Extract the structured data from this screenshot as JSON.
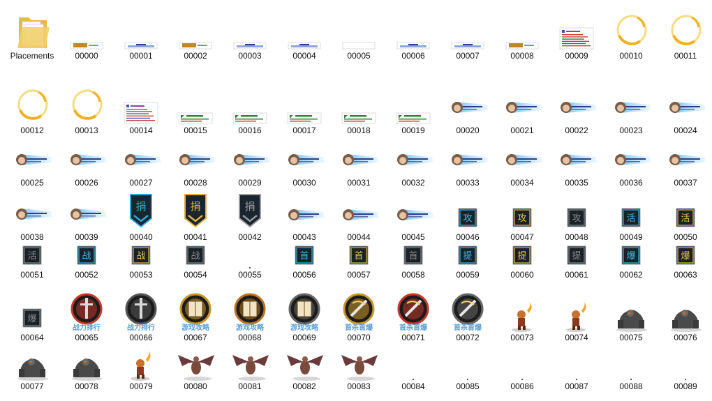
{
  "files": [
    {
      "label": "Placements",
      "icon": "folder-icon"
    },
    {
      "label": "00000",
      "icon": "title-strip-icon"
    },
    {
      "label": "00001",
      "icon": "blue-strip-icon"
    },
    {
      "label": "00002",
      "icon": "title-strip-icon"
    },
    {
      "label": "00003",
      "icon": "blue-strip-icon"
    },
    {
      "label": "00004",
      "icon": "blue-strip-icon"
    },
    {
      "label": "00005",
      "icon": "blank-strip-icon"
    },
    {
      "label": "00006",
      "icon": "blue-strip-icon"
    },
    {
      "label": "00007",
      "icon": "blue-strip-icon"
    },
    {
      "label": "00008",
      "icon": "title-strip-icon"
    },
    {
      "label": "00009",
      "icon": "text-panel-icon"
    },
    {
      "label": "00010",
      "icon": "golden-ring-icon"
    },
    {
      "label": "00011",
      "icon": "golden-ring-icon"
    },
    {
      "label": "00012",
      "icon": "golden-ring-icon"
    },
    {
      "label": "00013",
      "icon": "golden-ring-icon"
    },
    {
      "label": "00014",
      "icon": "text-panel-icon"
    },
    {
      "label": "00015",
      "icon": "green-text-strip-icon"
    },
    {
      "label": "00016",
      "icon": "green-text-strip-icon"
    },
    {
      "label": "00017",
      "icon": "green-text-strip-icon"
    },
    {
      "label": "00018",
      "icon": "green-text-strip-icon"
    },
    {
      "label": "00019",
      "icon": "green-text-strip-icon"
    },
    {
      "label": "00020",
      "icon": "portrait-banner-icon"
    },
    {
      "label": "00021",
      "icon": "portrait-banner-icon"
    },
    {
      "label": "00022",
      "icon": "portrait-banner-icon"
    },
    {
      "label": "00023",
      "icon": "portrait-banner-icon"
    },
    {
      "label": "00024",
      "icon": "portrait-banner-icon"
    },
    {
      "label": "00025",
      "icon": "portrait-banner-icon"
    },
    {
      "label": "00026",
      "icon": "portrait-banner-icon"
    },
    {
      "label": "00027",
      "icon": "portrait-banner-icon"
    },
    {
      "label": "00028",
      "icon": "portrait-banner-icon"
    },
    {
      "label": "00029",
      "icon": "portrait-banner-icon"
    },
    {
      "label": "00030",
      "icon": "portrait-banner-icon"
    },
    {
      "label": "00031",
      "icon": "portrait-banner-icon"
    },
    {
      "label": "00032",
      "icon": "portrait-banner-icon"
    },
    {
      "label": "00033",
      "icon": "portrait-banner-icon"
    },
    {
      "label": "00034",
      "icon": "portrait-banner-icon"
    },
    {
      "label": "00035",
      "icon": "portrait-banner-icon"
    },
    {
      "label": "00036",
      "icon": "portrait-banner-icon"
    },
    {
      "label": "00037",
      "icon": "portrait-banner-icon"
    },
    {
      "label": "00038",
      "icon": "portrait-banner-icon"
    },
    {
      "label": "00039",
      "icon": "portrait-banner-icon"
    },
    {
      "label": "00040",
      "icon": "shield-badge-icon",
      "glyph": "捐",
      "color": "#2aa8d8"
    },
    {
      "label": "00041",
      "icon": "shield-badge-icon",
      "glyph": "捐",
      "color": "#e0b040"
    },
    {
      "label": "00042",
      "icon": "shield-badge-icon",
      "glyph": "捐",
      "color": "#9a9a9a"
    },
    {
      "label": "00043",
      "icon": "portrait-strip-icon"
    },
    {
      "label": "00044",
      "icon": "portrait-strip-icon"
    },
    {
      "label": "00045",
      "icon": "portrait-strip-icon"
    },
    {
      "label": "00046",
      "icon": "square-glyph-icon",
      "glyph": "攻",
      "color": "#3fb6e6"
    },
    {
      "label": "00047",
      "icon": "square-glyph-icon",
      "glyph": "攻",
      "color": "#e3c04a"
    },
    {
      "label": "00048",
      "icon": "square-glyph-icon",
      "glyph": "攻",
      "color": "#8a8a8a"
    },
    {
      "label": "00049",
      "icon": "square-glyph-icon",
      "glyph": "活",
      "color": "#3fb6e6"
    },
    {
      "label": "00050",
      "icon": "square-glyph-icon",
      "glyph": "活",
      "color": "#e3c04a"
    },
    {
      "label": "00051",
      "icon": "square-glyph-icon",
      "glyph": "活",
      "color": "#8a8a8a"
    },
    {
      "label": "00052",
      "icon": "square-glyph-icon",
      "glyph": "战",
      "color": "#3fb6e6"
    },
    {
      "label": "00053",
      "icon": "square-glyph-icon",
      "glyph": "战",
      "color": "#e3c04a"
    },
    {
      "label": "00054",
      "icon": "square-glyph-icon",
      "glyph": "战",
      "color": "#8a8a8a"
    },
    {
      "label": "00055",
      "icon": "tiny-dot-icon"
    },
    {
      "label": "00056",
      "icon": "square-glyph-icon",
      "glyph": "首",
      "color": "#3fb6e6"
    },
    {
      "label": "00057",
      "icon": "square-glyph-icon",
      "glyph": "首",
      "color": "#e3c04a"
    },
    {
      "label": "00058",
      "icon": "square-glyph-icon",
      "glyph": "首",
      "color": "#8a8a8a"
    },
    {
      "label": "00059",
      "icon": "square-glyph-icon",
      "glyph": "提",
      "color": "#3fb6e6"
    },
    {
      "label": "00060",
      "icon": "square-glyph-icon",
      "glyph": "提",
      "color": "#e3c04a"
    },
    {
      "label": "00061",
      "icon": "square-glyph-icon",
      "glyph": "提",
      "color": "#8a8a8a"
    },
    {
      "label": "00062",
      "icon": "square-glyph-icon",
      "glyph": "爆",
      "color": "#3fb6e6"
    },
    {
      "label": "00063",
      "icon": "square-glyph-icon",
      "glyph": "爆",
      "color": "#e3c04a"
    },
    {
      "label": "00064",
      "icon": "square-glyph-icon",
      "glyph": "爆",
      "color": "#8a8a8a"
    },
    {
      "label": "00065",
      "icon": "round-emblem-icon",
      "emblem": "sword",
      "color": "#c0392b",
      "caption": "战力排行"
    },
    {
      "label": "00066",
      "icon": "round-emblem-icon",
      "emblem": "sword",
      "color": "#555555",
      "caption": "战力排行"
    },
    {
      "label": "00067",
      "icon": "round-emblem-icon",
      "emblem": "book",
      "color": "#c9962a",
      "caption": "游戏攻略"
    },
    {
      "label": "00068",
      "icon": "round-emblem-icon",
      "emblem": "book",
      "color": "#b8741f",
      "caption": "游戏攻略"
    },
    {
      "label": "00069",
      "icon": "round-emblem-icon",
      "emblem": "book",
      "color": "#666666",
      "caption": "游戏攻略"
    },
    {
      "label": "00070",
      "icon": "round-emblem-icon",
      "emblem": "blade",
      "color": "#c9962a",
      "caption": "首杀首爆"
    },
    {
      "label": "00071",
      "icon": "round-emblem-icon",
      "emblem": "blade",
      "color": "#c0392b",
      "caption": "首杀首爆"
    },
    {
      "label": "00072",
      "icon": "round-emblem-icon",
      "emblem": "blade",
      "color": "#666666",
      "caption": "首杀首爆"
    },
    {
      "label": "00073",
      "icon": "fire-warrior-sprite-icon"
    },
    {
      "label": "00074",
      "icon": "fire-warrior-sprite-icon"
    },
    {
      "label": "00075",
      "icon": "golem-sprite-icon"
    },
    {
      "label": "00076",
      "icon": "golem-sprite-icon"
    },
    {
      "label": "00077",
      "icon": "golem-sprite-icon"
    },
    {
      "label": "00078",
      "icon": "golem-sprite-icon"
    },
    {
      "label": "00079",
      "icon": "fire-warrior-sprite-icon"
    },
    {
      "label": "00080",
      "icon": "dragon-sprite-icon"
    },
    {
      "label": "00081",
      "icon": "dragon-sprite-icon"
    },
    {
      "label": "00082",
      "icon": "dragon-sprite-icon"
    },
    {
      "label": "00083",
      "icon": "dragon-sprite-icon"
    },
    {
      "label": "00084",
      "icon": "tiny-dot-icon"
    },
    {
      "label": "00085",
      "icon": "tiny-dot-icon"
    },
    {
      "label": "00086",
      "icon": "tiny-dot-icon"
    },
    {
      "label": "00087",
      "icon": "tiny-dot-icon"
    },
    {
      "label": "00088",
      "icon": "tiny-dot-icon"
    },
    {
      "label": "00089",
      "icon": "tiny-dot-icon"
    }
  ]
}
